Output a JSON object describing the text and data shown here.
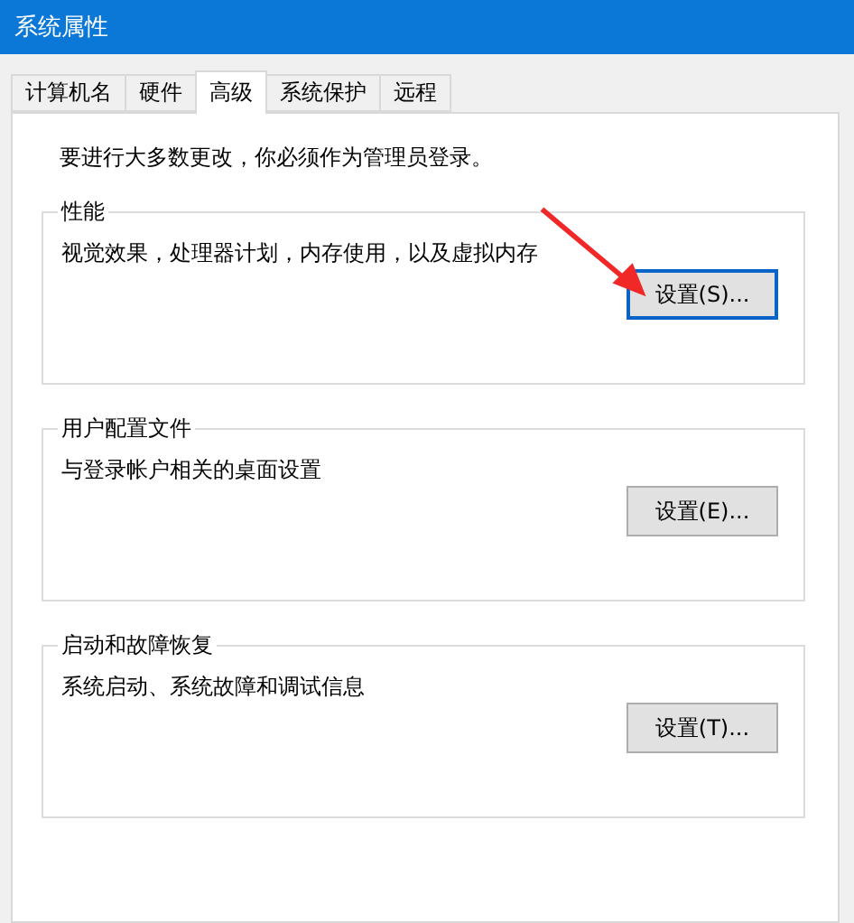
{
  "window": {
    "title": "系统属性"
  },
  "tabs": [
    {
      "label": "计算机名",
      "selected": false
    },
    {
      "label": "硬件",
      "selected": false
    },
    {
      "label": "高级",
      "selected": true
    },
    {
      "label": "系统保护",
      "selected": false
    },
    {
      "label": "远程",
      "selected": false
    }
  ],
  "notice": "要进行大多数更改，你必须作为管理员登录。",
  "groups": [
    {
      "title": "性能",
      "description": "视觉效果，处理器计划，内存使用，以及虚拟内存",
      "button": {
        "label": "设置(S)...",
        "focused": true
      }
    },
    {
      "title": "用户配置文件",
      "description": "与登录帐户相关的桌面设置",
      "button": {
        "label": "设置(E)...",
        "focused": false
      }
    },
    {
      "title": "启动和故障恢复",
      "description": "系统启动、系统故障和调试信息",
      "button": {
        "label": "设置(T)...",
        "focused": false
      }
    }
  ]
}
